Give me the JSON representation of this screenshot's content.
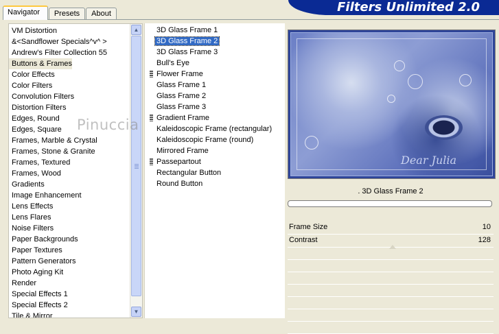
{
  "tabs": [
    {
      "label": "Navigator",
      "active": true
    },
    {
      "label": "Presets",
      "active": false
    },
    {
      "label": "About",
      "active": false
    }
  ],
  "header": {
    "title": "Filters Unlimited 2.0",
    "color": "#0a2a94"
  },
  "categories": {
    "items": [
      "VM Distortion",
      "&<Sandflower Specials^v^ >",
      "Andrew's Filter Collection 55",
      "Buttons & Frames",
      "Color Effects",
      "Color Filters",
      "Convolution Filters",
      "Distortion Filters",
      "Edges, Round",
      "Edges, Square",
      "Frames, Marble & Crystal",
      "Frames, Stone & Granite",
      "Frames, Textured",
      "Frames, Wood",
      "Gradients",
      "Image Enhancement",
      "Lens Effects",
      "Lens Flares",
      "Noise Filters",
      "Paper Backgrounds",
      "Paper Textures",
      "Pattern Generators",
      "Photo Aging Kit",
      "Render",
      "Special Effects 1",
      "Special Effects 2",
      "Tile & Mirror"
    ],
    "selected": "Buttons & Frames"
  },
  "filters": {
    "items": [
      {
        "label": "3D Glass Frame 1",
        "group": false
      },
      {
        "label": "3D Glass Frame 2",
        "group": false
      },
      {
        "label": "3D Glass Frame 3",
        "group": false
      },
      {
        "label": "Bull's Eye",
        "group": false
      },
      {
        "label": "Flower Frame",
        "group": true
      },
      {
        "label": "Glass Frame 1",
        "group": false
      },
      {
        "label": "Glass Frame 2",
        "group": false
      },
      {
        "label": "Glass Frame 3",
        "group": false
      },
      {
        "label": "Gradient Frame",
        "group": true
      },
      {
        "label": "Kaleidoscopic Frame (rectangular)",
        "group": false
      },
      {
        "label": "Kaleidoscopic Frame (round)",
        "group": false
      },
      {
        "label": "Mirrored Frame",
        "group": false
      },
      {
        "label": "Passepartout",
        "group": true
      },
      {
        "label": "Rectangular Button",
        "group": false
      },
      {
        "label": "Round Button",
        "group": false
      }
    ],
    "selected": "3D Glass Frame 2"
  },
  "preview": {
    "signature": "Dear Julia"
  },
  "current_filter_label": ". 3D Glass Frame 2",
  "parameters": [
    {
      "label": "Frame Size",
      "value": "10"
    },
    {
      "label": "Contrast",
      "value": "128"
    }
  ],
  "watermark": "Pinuccia",
  "colors": {
    "selection": "#316ac5",
    "panel": "#ece9d8",
    "preview_tint": "#6b7fc6"
  }
}
